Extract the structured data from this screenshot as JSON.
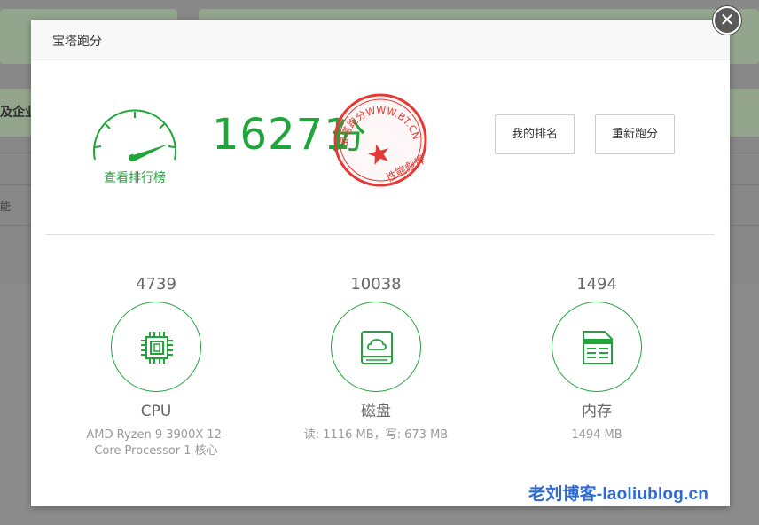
{
  "background": {
    "band_text": "及企业",
    "row_text": "能"
  },
  "modal": {
    "title": "宝塔跑分",
    "close_glyph": "✕"
  },
  "gauge": {
    "label": "查看排行榜"
  },
  "score": {
    "value": "16271",
    "unit": "分"
  },
  "stamp": {
    "top_text": "宝塔跑分WWW.BT.CN",
    "bottom_text": "性能彪悍",
    "color": "#e53935"
  },
  "buttons": {
    "rank": "我的排名",
    "rerun": "重新跑分"
  },
  "metrics": {
    "cpu": {
      "value": "4739",
      "name": "CPU",
      "detail": "AMD Ryzen 9 3900X 12-Core Processor 1 核心",
      "icon": "cpu-chip-icon"
    },
    "disk": {
      "value": "10038",
      "name": "磁盘",
      "detail": "读: 1116 MB，写: 673 MB",
      "icon": "disk-cloud-icon"
    },
    "memory": {
      "value": "1494",
      "name": "内存",
      "detail": "1494 MB",
      "icon": "memory-document-icon"
    }
  },
  "watermark": "老刘博客-laoliublog.cn",
  "colors": {
    "accent": "#20a53a",
    "watermark": "#2d6bd8"
  }
}
